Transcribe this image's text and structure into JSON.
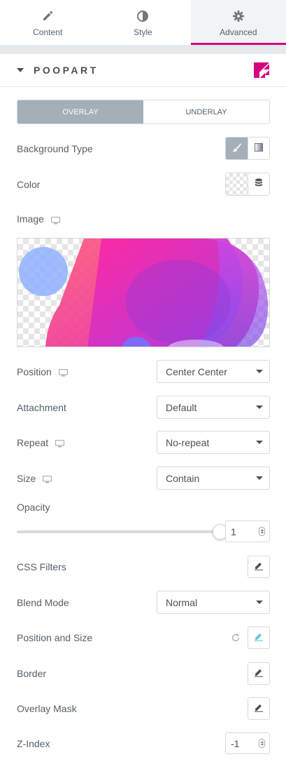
{
  "tabs": [
    {
      "label": "Content",
      "icon": "pencil-icon",
      "active": false
    },
    {
      "label": "Style",
      "icon": "contrast-icon",
      "active": false
    },
    {
      "label": "Advanced",
      "icon": "gear-icon",
      "active": true
    }
  ],
  "section": {
    "title": "POOPART",
    "icon": "poopart-logo"
  },
  "layer_switch": {
    "overlay": "OVERLAY",
    "underlay": "UNDERLAY",
    "active": "overlay"
  },
  "controls": {
    "background_type": {
      "label": "Background Type",
      "options": [
        "brush-icon",
        "gradient-icon"
      ],
      "active": "brush-icon"
    },
    "color": {
      "label": "Color"
    },
    "image": {
      "label": "Image"
    },
    "position": {
      "label": "Position",
      "value": "Center Center"
    },
    "attachment": {
      "label": "Attachment",
      "value": "Default"
    },
    "repeat": {
      "label": "Repeat",
      "value": "No-repeat"
    },
    "size": {
      "label": "Size",
      "value": "Contain"
    },
    "opacity": {
      "label": "Opacity",
      "value": "1",
      "fraction": 1
    },
    "css_filters": {
      "label": "CSS Filters"
    },
    "blend_mode": {
      "label": "Blend Mode",
      "value": "Normal"
    },
    "position_and_size": {
      "label": "Position and Size"
    },
    "border": {
      "label": "Border"
    },
    "overlay_mask": {
      "label": "Overlay Mask"
    },
    "z_index": {
      "label": "Z-Index",
      "value": "-1"
    }
  },
  "colors": {
    "accent": "#d5007f",
    "active_button": "#a4afb7",
    "highlight_edit": "#5bc0de"
  }
}
